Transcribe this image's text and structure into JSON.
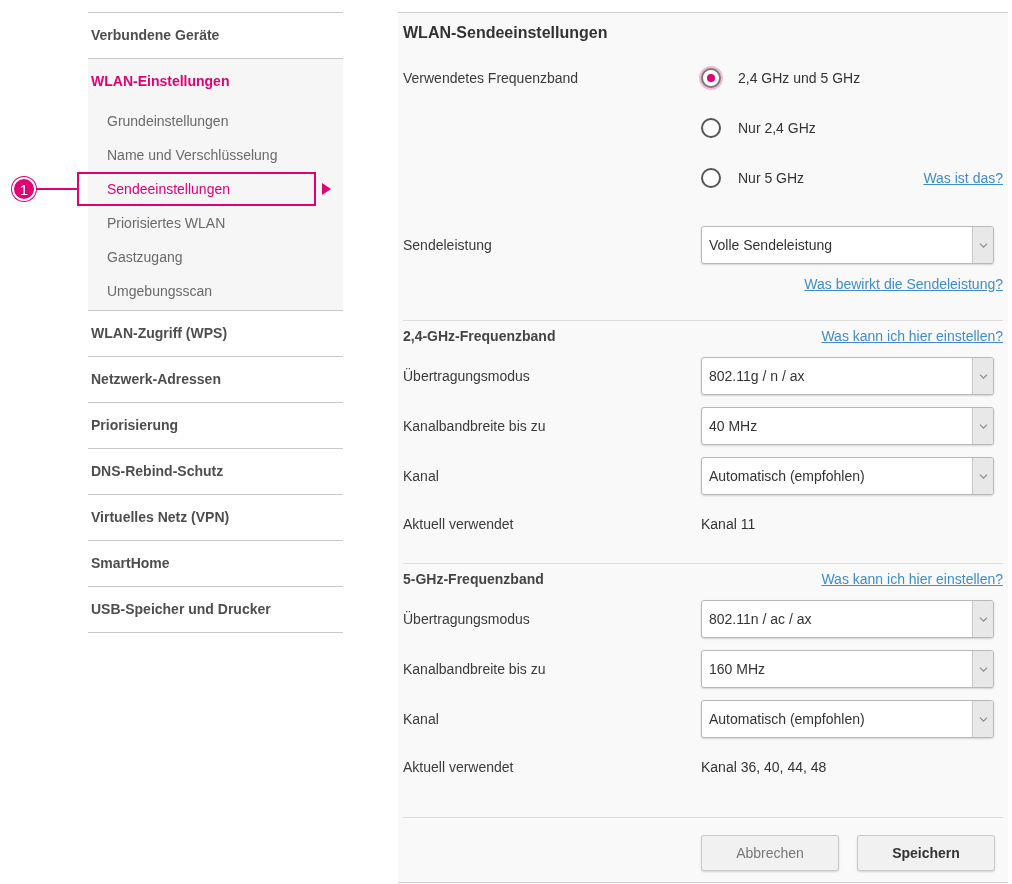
{
  "sidebar": {
    "items": [
      {
        "label": "Verbundene Geräte",
        "selected": false
      },
      {
        "label": "WLAN-Einstellungen",
        "selected": true,
        "children": [
          {
            "label": "Grundeinstellungen",
            "selected": false
          },
          {
            "label": "Name und Verschlüsselung",
            "selected": false
          },
          {
            "label": "Sendeeinstellungen",
            "selected": true,
            "callout": "1"
          },
          {
            "label": "Priorisiertes WLAN",
            "selected": false
          },
          {
            "label": "Gastzugang",
            "selected": false
          },
          {
            "label": "Umgebungsscan",
            "selected": false
          }
        ]
      },
      {
        "label": "WLAN-Zugriff (WPS)",
        "selected": false
      },
      {
        "label": "Netzwerk-Adressen",
        "selected": false
      },
      {
        "label": "Priorisierung",
        "selected": false
      },
      {
        "label": "DNS-Rebind-Schutz",
        "selected": false
      },
      {
        "label": "Virtuelles Netz (VPN)",
        "selected": false
      },
      {
        "label": "SmartHome",
        "selected": false
      },
      {
        "label": "USB-Speicher und Drucker",
        "selected": false
      }
    ]
  },
  "panel": {
    "title": "WLAN-Sendeeinstellungen",
    "frequency_band": {
      "label": "Verwendetes Frequenzband",
      "options": [
        {
          "label": "2,4 GHz und 5 GHz",
          "selected": true
        },
        {
          "label": "Nur 2,4 GHz",
          "selected": false
        },
        {
          "label": "Nur 5 GHz",
          "selected": false
        }
      ],
      "help_link": "Was ist das?"
    },
    "transmit_power": {
      "label": "Sendeleistung",
      "value": "Volle Sendeleistung",
      "help_link": "Was bewirkt die Sendeleistung?"
    },
    "bands": [
      {
        "title": "2,4-GHz-Frequenzband",
        "help_link": "Was kann ich hier einstellen?",
        "rows": [
          {
            "kind": "select",
            "label": "Übertragungsmodus",
            "value": "802.11g / n / ax"
          },
          {
            "kind": "select",
            "label": "Kanalbandbreite bis zu",
            "value": "40 MHz"
          },
          {
            "kind": "select",
            "label": "Kanal",
            "value": "Automatisch (empfohlen)"
          },
          {
            "kind": "text",
            "label": "Aktuell verwendet",
            "value": "Kanal 11"
          }
        ]
      },
      {
        "title": "5-GHz-Frequenzband",
        "help_link": "Was kann ich hier einstellen?",
        "rows": [
          {
            "kind": "select",
            "label": "Übertragungsmodus",
            "value": "802.11n / ac / ax"
          },
          {
            "kind": "select",
            "label": "Kanalbandbreite bis zu",
            "value": "160 MHz"
          },
          {
            "kind": "select",
            "label": "Kanal",
            "value": "Automatisch (empfohlen)"
          },
          {
            "kind": "text",
            "label": "Aktuell verwendet",
            "value": "Kanal 36, 40, 44, 48"
          }
        ]
      }
    ],
    "buttons": [
      {
        "label": "Abbrechen",
        "kind": "secondary"
      },
      {
        "label": "Speichern",
        "kind": "primary"
      }
    ]
  }
}
